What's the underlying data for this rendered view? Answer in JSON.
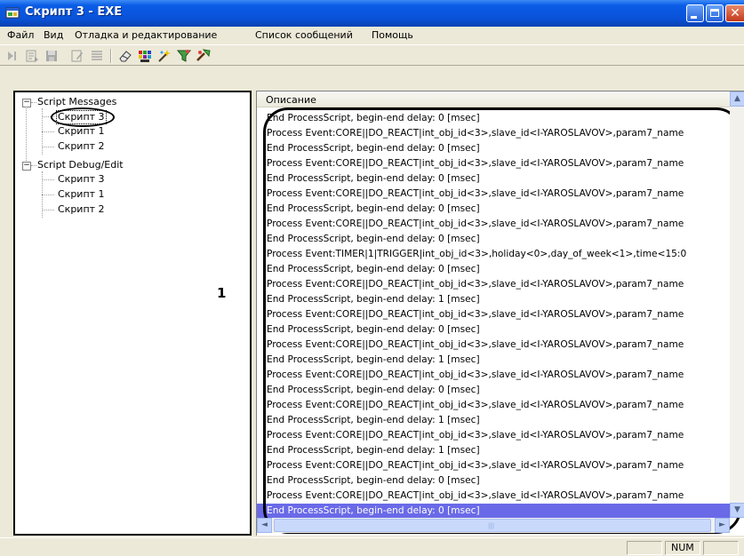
{
  "window": {
    "title": "Скрипт 3 - EXE",
    "icon": "app-window-icon",
    "controls": [
      "minimize-icon",
      "maximize-icon",
      "close-icon"
    ]
  },
  "menu": {
    "file": "Файл",
    "view": "Вид",
    "debug": "Отладка и редактирование",
    "messages": "Список сообщений",
    "help": "Помощь"
  },
  "toolbar": {
    "icons": [
      "run-icon",
      "step-icon",
      "save-icon",
      "edit-icon",
      "list-icon",
      "eraser-icon",
      "palette-icon",
      "wizard-icon",
      "filter-icon",
      "tools-icon"
    ]
  },
  "tree": {
    "root1": "Script Messages",
    "root1_children": [
      "Скрипт 3",
      "Скрипт 1",
      "Скрипт 2"
    ],
    "root2": "Script Debug/Edit",
    "root2_children": [
      "Скрипт 3",
      "Скрипт 1",
      "Скрипт 2"
    ],
    "expander": "−"
  },
  "annotation": {
    "label": "1"
  },
  "list": {
    "header": "Описание",
    "rows": [
      "End ProcessScript, begin-end delay: 0 [msec]",
      "Process Event:CORE||DO_REACT|int_obj_id<3>,slave_id<I-YAROSLAVOV>,param7_name",
      "End ProcessScript, begin-end delay: 0 [msec]",
      "Process Event:CORE||DO_REACT|int_obj_id<3>,slave_id<I-YAROSLAVOV>,param7_name",
      "End ProcessScript, begin-end delay: 0 [msec]",
      "Process Event:CORE||DO_REACT|int_obj_id<3>,slave_id<I-YAROSLAVOV>,param7_name",
      "End ProcessScript, begin-end delay: 0 [msec]",
      "Process Event:CORE||DO_REACT|int_obj_id<3>,slave_id<I-YAROSLAVOV>,param7_name",
      "End ProcessScript, begin-end delay: 0 [msec]",
      "Process Event:TIMER|1|TRIGGER|int_obj_id<3>,holiday<0>,day_of_week<1>,time<15:0",
      "End ProcessScript, begin-end delay: 0 [msec]",
      "Process Event:CORE||DO_REACT|int_obj_id<3>,slave_id<I-YAROSLAVOV>,param7_name",
      "End ProcessScript, begin-end delay: 1 [msec]",
      "Process Event:CORE||DO_REACT|int_obj_id<3>,slave_id<I-YAROSLAVOV>,param7_name",
      "End ProcessScript, begin-end delay: 0 [msec]",
      "Process Event:CORE||DO_REACT|int_obj_id<3>,slave_id<I-YAROSLAVOV>,param7_name",
      "End ProcessScript, begin-end delay: 1 [msec]",
      "Process Event:CORE||DO_REACT|int_obj_id<3>,slave_id<I-YAROSLAVOV>,param7_name",
      "End ProcessScript, begin-end delay: 0 [msec]",
      "Process Event:CORE||DO_REACT|int_obj_id<3>,slave_id<I-YAROSLAVOV>,param7_name",
      "End ProcessScript, begin-end delay: 1 [msec]",
      "Process Event:CORE||DO_REACT|int_obj_id<3>,slave_id<I-YAROSLAVOV>,param7_name",
      "End ProcessScript, begin-end delay: 1 [msec]",
      "Process Event:CORE||DO_REACT|int_obj_id<3>,slave_id<I-YAROSLAVOV>,param7_name",
      "End ProcessScript, begin-end delay: 0 [msec]",
      "Process Event:CORE||DO_REACT|int_obj_id<3>,slave_id<I-YAROSLAVOV>,param7_name",
      "End ProcessScript, begin-end delay: 0 [msec]"
    ],
    "selected_index": 26
  },
  "scroll": {
    "up": "▲",
    "down": "▼",
    "left": "◄",
    "right": "►",
    "grip": "|||"
  },
  "status": {
    "num": "NUM"
  },
  "colors": {
    "title_bar": "#0a52d8",
    "selection": "#6a6ae8",
    "face": "#ece9d8"
  }
}
